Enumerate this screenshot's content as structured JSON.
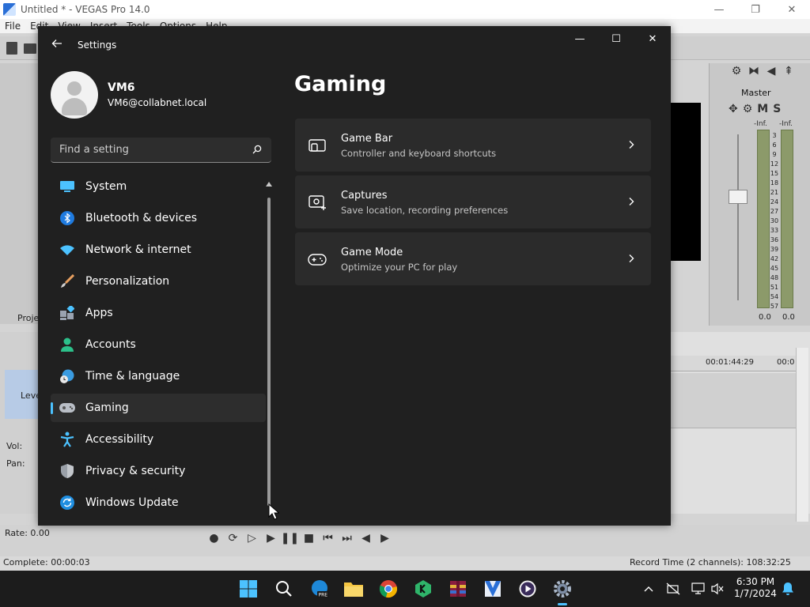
{
  "vegas": {
    "title": "Untitled * - VEGAS Pro 14.0",
    "menu": [
      "File",
      "Edit",
      "View",
      "Insert",
      "Tools",
      "Options",
      "Help"
    ],
    "window_controls": {
      "minimize": "—",
      "restore": "❐",
      "close": "✕"
    },
    "project_label": "Proje",
    "master_label": "Master",
    "mute_solo": {
      "m": "M",
      "s": "S"
    },
    "inf_left": "-Inf.",
    "inf_right": "-Inf.",
    "meter_scale": [
      "3",
      "6",
      "9",
      "12",
      "15",
      "18",
      "21",
      "24",
      "27",
      "30",
      "33",
      "36",
      "39",
      "42",
      "45",
      "48",
      "51",
      "54",
      "57"
    ],
    "readout_left": "0.0",
    "readout_right": "0.0",
    "timecode_1": "00:01:44:29",
    "timecode_2": "00:0",
    "track_level": "Leve",
    "vol_label": "Vol:",
    "pan_label": "Pan:",
    "rate": "Rate: 0.00",
    "complete": "Complete: 00:00:03",
    "record_time": "Record Time (2 channels): 108:32:25"
  },
  "settings": {
    "window_title": "Settings",
    "back_icon": "back-arrow-icon",
    "controls": {
      "minimize": "—",
      "maximize": "☐",
      "close": "✕"
    },
    "user": {
      "name": "VM6",
      "email": "VM6@collabnet.local"
    },
    "search": {
      "placeholder": "Find a setting"
    },
    "nav": [
      {
        "label": "System",
        "icon": "system-icon"
      },
      {
        "label": "Bluetooth & devices",
        "icon": "bluetooth-icon"
      },
      {
        "label": "Network & internet",
        "icon": "wifi-icon"
      },
      {
        "label": "Personalization",
        "icon": "brush-icon"
      },
      {
        "label": "Apps",
        "icon": "apps-icon"
      },
      {
        "label": "Accounts",
        "icon": "accounts-icon"
      },
      {
        "label": "Time & language",
        "icon": "globe-clock-icon"
      },
      {
        "label": "Gaming",
        "icon": "gamepad-icon",
        "selected": true
      },
      {
        "label": "Accessibility",
        "icon": "accessibility-icon"
      },
      {
        "label": "Privacy & security",
        "icon": "shield-icon"
      },
      {
        "label": "Windows Update",
        "icon": "update-icon"
      }
    ],
    "page_title": "Gaming",
    "cards": [
      {
        "title": "Game Bar",
        "subtitle": "Controller and keyboard shortcuts",
        "icon": "game-bar-icon"
      },
      {
        "title": "Captures",
        "subtitle": "Save location, recording preferences",
        "icon": "captures-icon"
      },
      {
        "title": "Game Mode",
        "subtitle": "Optimize your PC for play",
        "icon": "game-mode-icon"
      }
    ]
  },
  "taskbar": {
    "apps": [
      "start-icon",
      "search-icon",
      "edge-beta-icon",
      "file-explorer-icon",
      "chrome-icon",
      "kaspersky-icon",
      "winrar-icon",
      "vegas-icon",
      "media-player-icon",
      "settings-icon"
    ],
    "time": "6:30 PM",
    "date": "1/7/2024",
    "tray": [
      "chevron-up-icon",
      "network-off-icon",
      "display-icon",
      "sound-muted-icon",
      "notification-bell-icon"
    ]
  },
  "colors": {
    "accent": "#4cc2ff",
    "settings_bg": "#202020",
    "card_bg": "#2b2b2b",
    "selected_bg": "#2d2d2d"
  }
}
